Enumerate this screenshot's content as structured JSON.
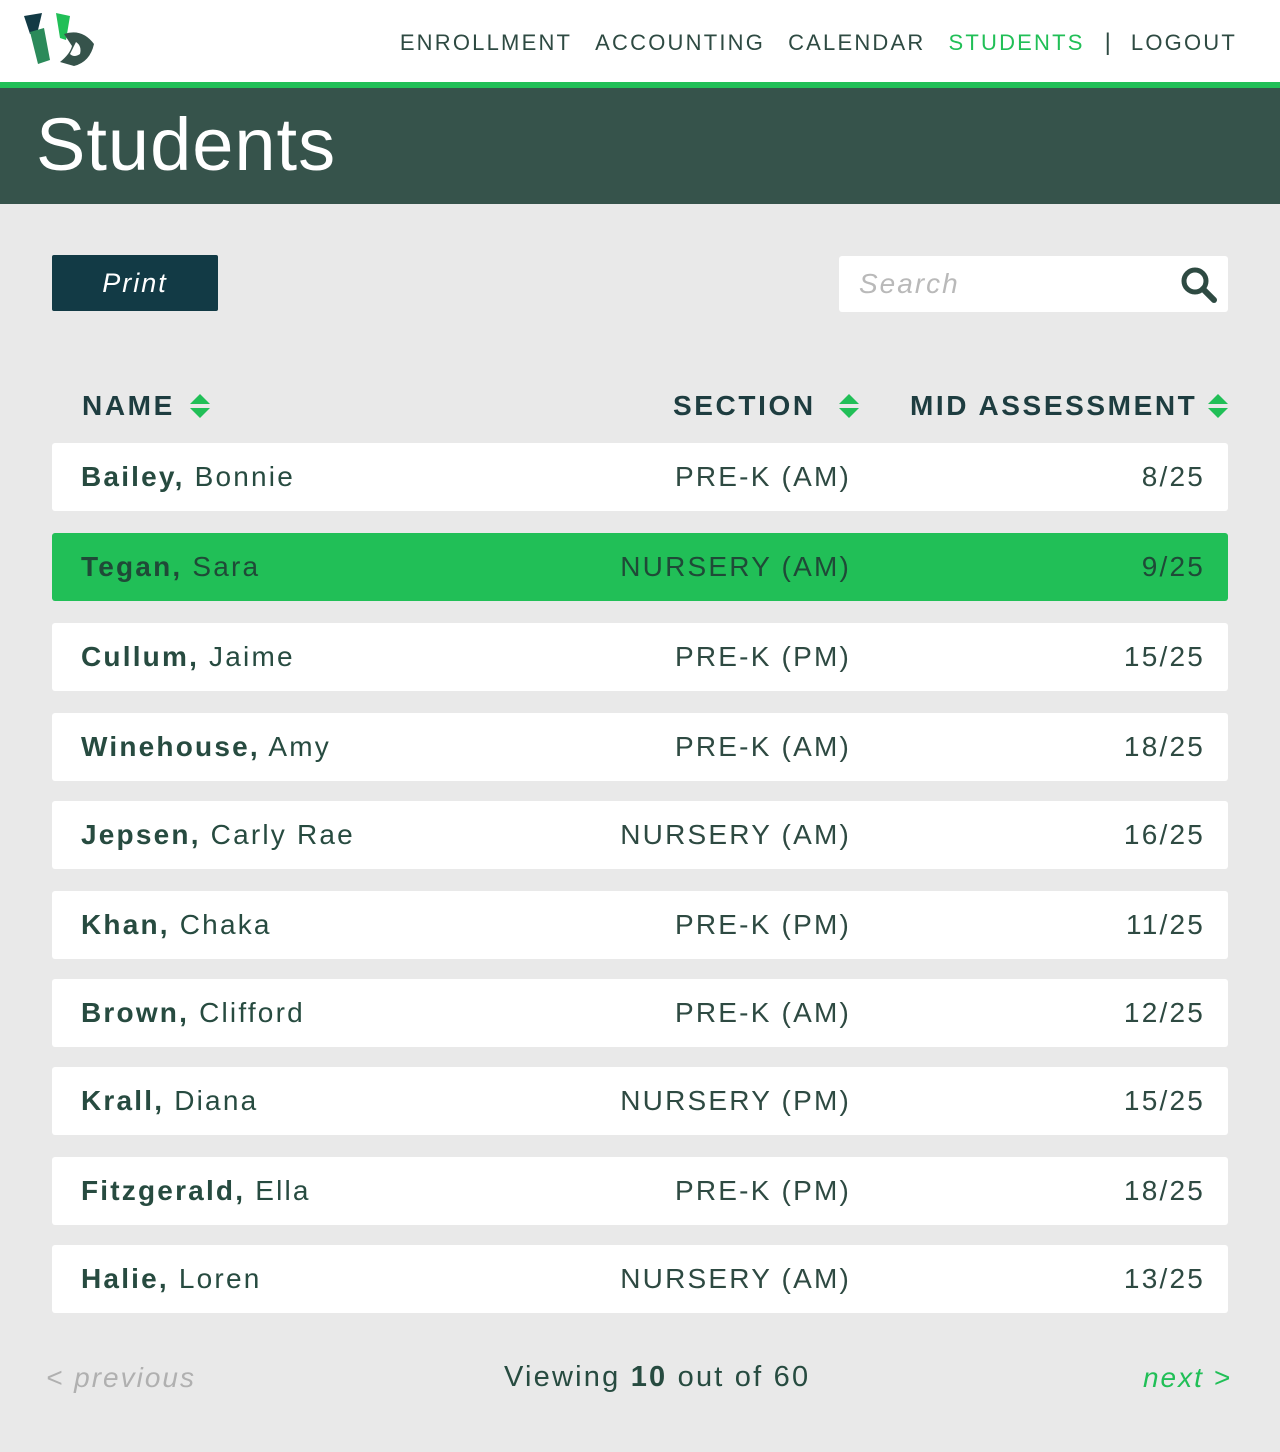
{
  "nav": {
    "items": [
      {
        "label": "ENROLLMENT",
        "active": false
      },
      {
        "label": "ACCOUNTING",
        "active": false
      },
      {
        "label": "CALENDAR",
        "active": false
      },
      {
        "label": "STUDENTS",
        "active": true
      }
    ],
    "separator": "|",
    "logout": "LOGOUT"
  },
  "page": {
    "title": "Students"
  },
  "toolbar": {
    "print_label": "Print",
    "search_placeholder": "Search",
    "search_value": ""
  },
  "table": {
    "columns": {
      "name": "NAME",
      "section": "SECTION",
      "mid": "MID ASSESSMENT"
    },
    "rows": [
      {
        "last": "Bailey,",
        "first": "Bonnie",
        "section": "PRE-K (AM)",
        "mid": "8/25",
        "selected": false
      },
      {
        "last": "Tegan,",
        "first": "Sara",
        "section": "NURSERY (AM)",
        "mid": "9/25",
        "selected": true
      },
      {
        "last": "Cullum,",
        "first": "Jaime",
        "section": "PRE-K (PM)",
        "mid": "15/25",
        "selected": false
      },
      {
        "last": "Winehouse,",
        "first": "Amy",
        "section": "PRE-K (AM)",
        "mid": "18/25",
        "selected": false
      },
      {
        "last": "Jepsen,",
        "first": "Carly Rae",
        "section": "NURSERY (AM)",
        "mid": "16/25",
        "selected": false
      },
      {
        "last": "Khan,",
        "first": "Chaka",
        "section": "PRE-K (PM)",
        "mid": "11/25",
        "selected": false
      },
      {
        "last": "Brown,",
        "first": "Clifford",
        "section": "PRE-K (AM)",
        "mid": "12/25",
        "selected": false
      },
      {
        "last": "Krall,",
        "first": "Diana",
        "section": "NURSERY (PM)",
        "mid": "15/25",
        "selected": false
      },
      {
        "last": "Fitzgerald,",
        "first": "Ella",
        "section": "PRE-K (PM)",
        "mid": "18/25",
        "selected": false
      },
      {
        "last": "Halie,",
        "first": "Loren",
        "section": "NURSERY (AM)",
        "mid": "13/25",
        "selected": false
      }
    ]
  },
  "pagination": {
    "previous": "< previous",
    "next": "next >",
    "viewing_prefix": "Viewing",
    "viewing_count": "10",
    "viewing_suffix": "out of 60"
  },
  "colors": {
    "accent": "#21bf57",
    "header_band": "#36534b",
    "print_button": "#123a45",
    "background": "#e9e9e9"
  },
  "icons": {
    "logo": "school-logo-icon",
    "search": "search-icon",
    "sort": "sort-arrows-icon"
  }
}
